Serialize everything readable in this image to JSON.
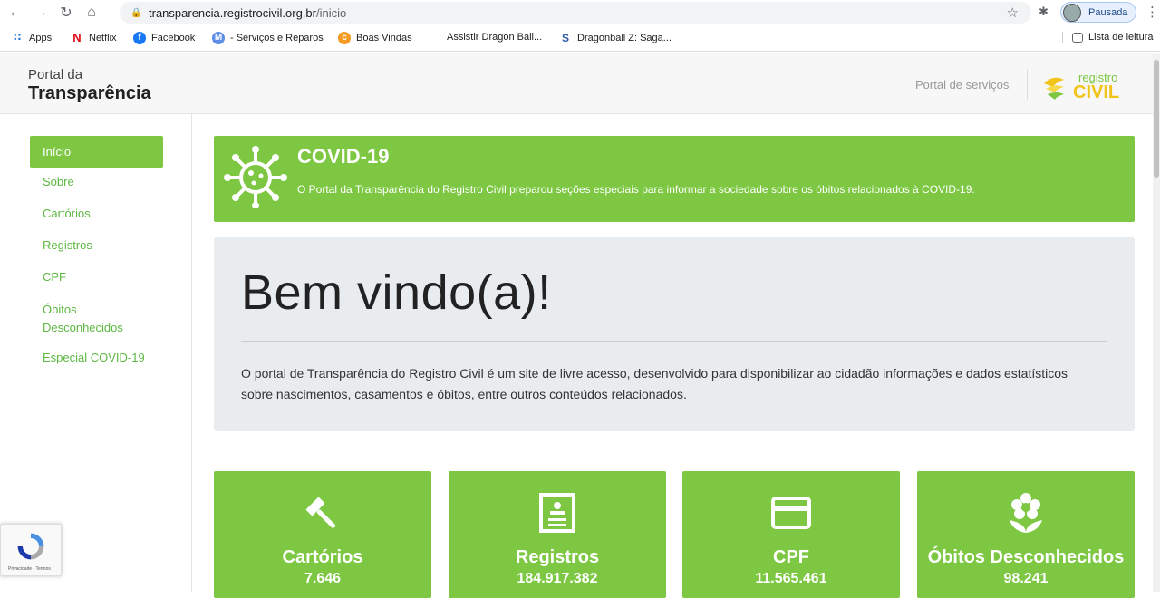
{
  "browser": {
    "url_domain": "transparencia.registrocivil.org.br",
    "url_path": "/inicio",
    "profile_label": "Pausada",
    "bookmarks": [
      {
        "label": "Apps",
        "icon": "apps-grid-icon",
        "color": "#1a73e8"
      },
      {
        "label": "Netflix",
        "icon": "netflix-icon",
        "color": "#e50914"
      },
      {
        "label": "Facebook",
        "icon": "facebook-icon",
        "color": "#1877f2"
      },
      {
        "label": "- Serviços e Reparos",
        "icon": "motorola-icon",
        "color": "#5c8de8"
      },
      {
        "label": "Boas Vindas",
        "icon": "crunchyroll-icon",
        "color": "#f59a23"
      },
      {
        "label": "Assistir Dragon Ball...",
        "icon": "",
        "color": "#ffffff"
      },
      {
        "label": "Dragonball Z: Saga...",
        "icon": "saga-icon",
        "color": "#2a5aa8"
      }
    ],
    "reading_list": "Lista de leitura"
  },
  "header": {
    "logo_line1": "Portal da",
    "logo_line2": "Transparência",
    "services_link": "Portal de serviços",
    "brand_logo_text_1": "registro",
    "brand_logo_text_2": "CIVIL"
  },
  "sidebar": {
    "items": [
      {
        "label": "Início",
        "active": true
      },
      {
        "label": "Sobre"
      },
      {
        "label": "Cartórios"
      },
      {
        "label": "Registros"
      },
      {
        "label": "CPF"
      },
      {
        "label": "Óbitos Desconhecidos"
      },
      {
        "label": "Especial COVID-19"
      }
    ]
  },
  "covid_banner": {
    "title": "COVID-19",
    "text": "O Portal da Transparência do Registro Civil preparou seções especiais para informar a sociedade sobre os óbitos relacionados à COVID-19."
  },
  "welcome": {
    "title": "Bem vindo(a)!",
    "text": "O portal de Transparência do Registro Civil é um site de livre acesso, desenvolvido para disponibilizar ao cidadão informações e dados estatísticos sobre nascimentos, casamentos e óbitos, entre outros conteúdos relacionados."
  },
  "stats": [
    {
      "label": "Cartórios",
      "value": "7.646",
      "icon": "gavel-icon"
    },
    {
      "label": "Registros",
      "value": "184.917.382",
      "icon": "document-icon"
    },
    {
      "label": "CPF",
      "value": "11.565.461",
      "icon": "card-icon"
    },
    {
      "label": "Óbitos Desconhecidos",
      "value": "98.241",
      "icon": "flower-icon"
    }
  ],
  "recaptcha": {
    "text": "Privacidade - Termos"
  },
  "colors": {
    "accent": "#7dc743",
    "link": "#5cb841"
  }
}
